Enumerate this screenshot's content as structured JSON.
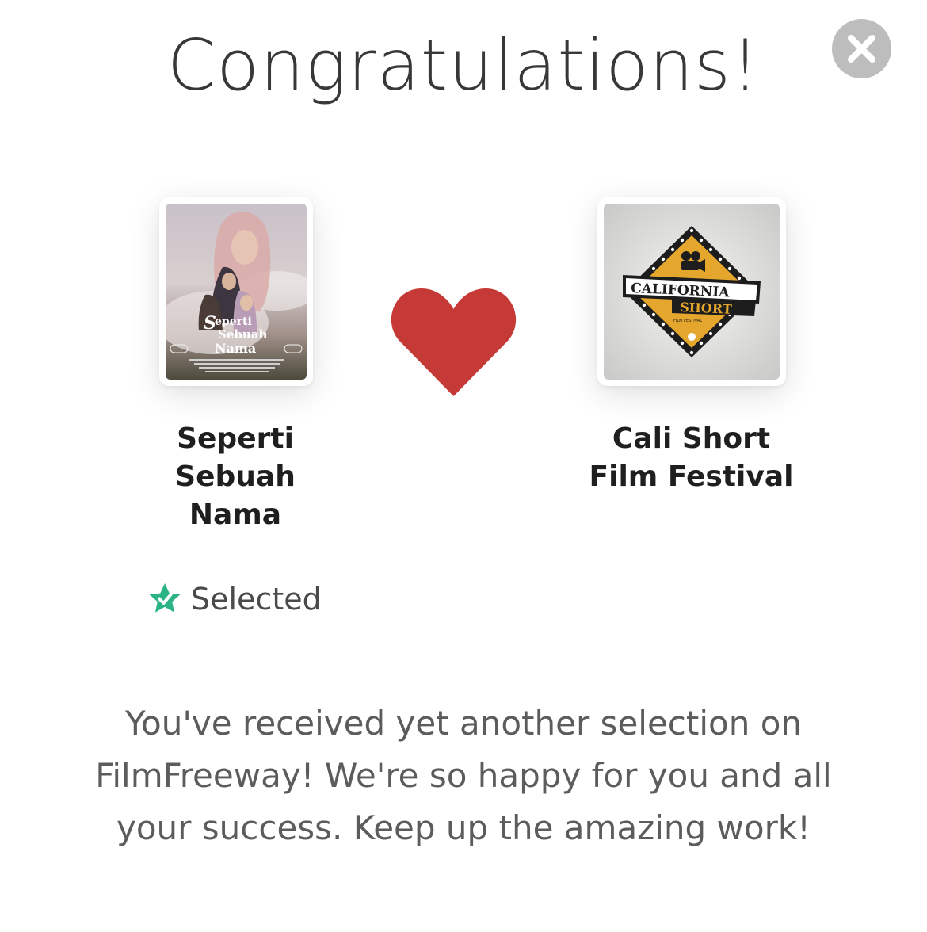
{
  "modal": {
    "title": "Congratulations!",
    "close_icon": "close-icon",
    "message": "You've received yet another selection on FilmFreeway! We're so happy for you and all your success. Keep up the amazing work!"
  },
  "film": {
    "name": "Seperti Sebuah Nama",
    "poster_title": "Seperti Sebuah Nama",
    "status": "Selected",
    "status_icon": "star-check-icon"
  },
  "festival": {
    "name": "Cali Short Film Festival",
    "logo_line1": "CALIFORNIA",
    "logo_line2": "SHORT",
    "logo_line3": "FILM FESTIVAL"
  },
  "colors": {
    "heart": "#C53A36",
    "status_green": "#2BB386",
    "close_bg": "#BDBDBD",
    "logo_gold": "#E4A62C"
  }
}
